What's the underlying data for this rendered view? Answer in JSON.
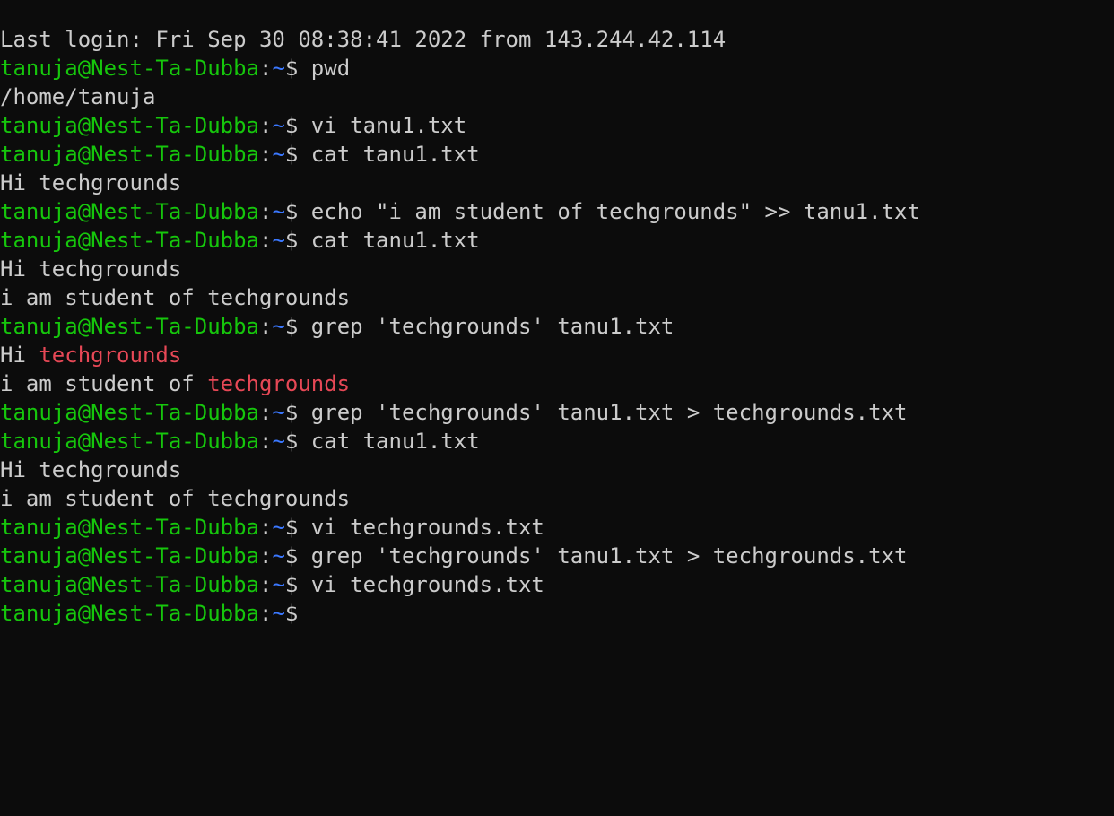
{
  "terminal": {
    "prompt": {
      "user_host": "tanuja@Nest-Ta-Dubba",
      "colon": ":",
      "path": "~",
      "symbol": "$ "
    },
    "colors": {
      "background": "#0c0c0c",
      "text": "#cccccc",
      "prompt_user": "#16c60c",
      "prompt_path": "#3b78ff",
      "grep_match": "#e74856"
    },
    "lines": [
      {
        "type": "output",
        "text": "Last login: Fri Sep 30 08:38:41 2022 from 143.244.42.114"
      },
      {
        "type": "prompt",
        "command": "pwd"
      },
      {
        "type": "output",
        "text": "/home/tanuja"
      },
      {
        "type": "prompt",
        "command": "vi tanu1.txt"
      },
      {
        "type": "prompt",
        "command": "cat tanu1.txt"
      },
      {
        "type": "output",
        "text": "Hi techgrounds"
      },
      {
        "type": "prompt",
        "command": "echo \"i am student of techgrounds\" >> tanu1.txt"
      },
      {
        "type": "prompt",
        "command": "cat tanu1.txt"
      },
      {
        "type": "output",
        "text": "Hi techgrounds"
      },
      {
        "type": "output",
        "text": "i am student of techgrounds"
      },
      {
        "type": "prompt",
        "command": "grep 'techgrounds' tanu1.txt"
      },
      {
        "type": "match",
        "prefix": "Hi ",
        "match": "techgrounds"
      },
      {
        "type": "match",
        "prefix": "i am student of ",
        "match": "techgrounds"
      },
      {
        "type": "prompt",
        "command": "grep 'techgrounds' tanu1.txt > techgrounds.txt"
      },
      {
        "type": "prompt",
        "command": "cat tanu1.txt"
      },
      {
        "type": "output",
        "text": "Hi techgrounds"
      },
      {
        "type": "output",
        "text": "i am student of techgrounds"
      },
      {
        "type": "prompt",
        "command": "vi techgrounds.txt"
      },
      {
        "type": "prompt",
        "command": "grep 'techgrounds' tanu1.txt > techgrounds.txt"
      },
      {
        "type": "prompt",
        "command": "vi techgrounds.txt"
      },
      {
        "type": "prompt",
        "command": ""
      }
    ]
  }
}
